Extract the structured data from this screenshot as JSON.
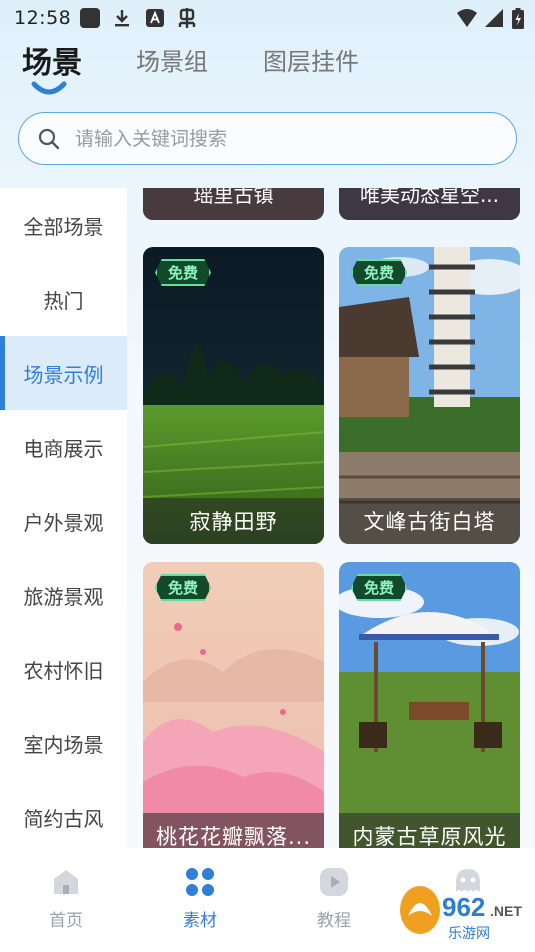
{
  "status_bar": {
    "time": "12:58",
    "icons": [
      "app-square-icon",
      "download-icon",
      "a-box-icon",
      "bug-icon",
      "wifi-icon",
      "signal-icon",
      "battery-icon"
    ]
  },
  "top_tabs": [
    {
      "label": "场景",
      "active": true
    },
    {
      "label": "场景组",
      "active": false
    },
    {
      "label": "图层挂件",
      "active": false
    }
  ],
  "search": {
    "placeholder": "请输入关键词搜索",
    "value": ""
  },
  "sidebar": {
    "items": [
      {
        "label": "全部场景",
        "active": false
      },
      {
        "label": "热门",
        "active": false
      },
      {
        "label": "场景示例",
        "active": true
      },
      {
        "label": "电商展示",
        "active": false
      },
      {
        "label": "户外景观",
        "active": false
      },
      {
        "label": "旅游景观",
        "active": false
      },
      {
        "label": "农村怀旧",
        "active": false
      },
      {
        "label": "室内场景",
        "active": false
      },
      {
        "label": "简约古风",
        "active": false
      }
    ]
  },
  "partial_cards": [
    {
      "caption": "瑶里古镇"
    },
    {
      "caption": "唯美动态星空..."
    }
  ],
  "cards": [
    {
      "badge": "免费",
      "caption": "寂静田野"
    },
    {
      "badge": "免费",
      "caption": "文峰古街白塔"
    },
    {
      "badge": "免费",
      "caption": "桃花花瓣飘落..."
    },
    {
      "badge": "免费",
      "caption": "内蒙古草原风光"
    }
  ],
  "bottom_nav": [
    {
      "label": "首页",
      "icon": "home-icon",
      "active": false
    },
    {
      "label": "素材",
      "icon": "material-grid-icon",
      "active": true
    },
    {
      "label": "教程",
      "icon": "tutorial-play-icon",
      "active": false
    },
    {
      "label": "我的",
      "icon": "profile-ghost-icon",
      "active": false
    }
  ],
  "watermark": {
    "brand": "962.NET",
    "subtitle": "乐游网"
  },
  "colors": {
    "accent": "#2f7fd8",
    "badge_bg": "#134a2c",
    "badge_border": "#5fe0a0",
    "sidebar_active_bg": "#dcebfa"
  }
}
